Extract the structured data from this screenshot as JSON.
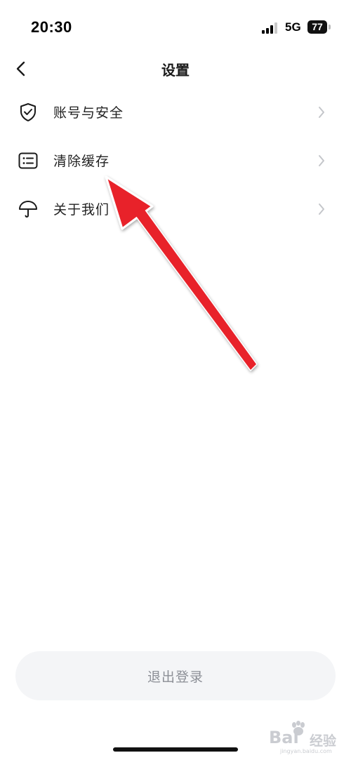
{
  "status_bar": {
    "time": "20:30",
    "network": "5G",
    "battery": "77",
    "signal_icon": "cellular-signal-icon"
  },
  "nav": {
    "title": "设置",
    "back_icon": "chevron-left-icon"
  },
  "menu": {
    "items": [
      {
        "label": "账号与安全",
        "icon": "shield-check-icon"
      },
      {
        "label": "清除缓存",
        "icon": "list-box-icon"
      },
      {
        "label": "关于我们",
        "icon": "umbrella-icon"
      }
    ],
    "chevron_icon": "chevron-right-icon"
  },
  "logout": {
    "label": "退出登录"
  },
  "annotation": {
    "color": "#e8202a",
    "points_to": "清除缓存"
  },
  "watermark": {
    "brand": "Bai",
    "brand_suffix": "经验",
    "url": "jingyan.baidu.com"
  },
  "colors": {
    "text_primary": "#1a1a1a",
    "logout_bg": "#f4f5f7",
    "logout_text": "#8c8f96",
    "chevron": "#c4c6ca"
  }
}
